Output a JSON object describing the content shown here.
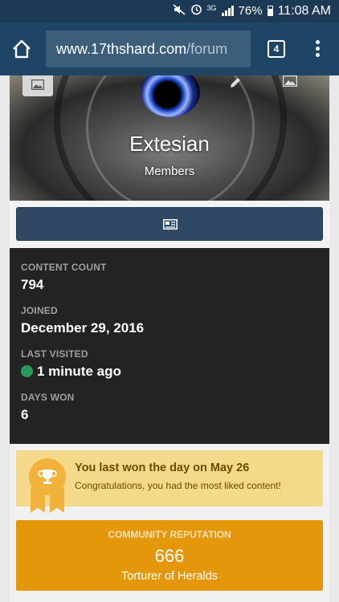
{
  "status_bar": {
    "battery": "76%",
    "time": "11:08 AM",
    "network": "3G"
  },
  "browser": {
    "url_domain": "www.17thshard.com",
    "url_path": "/forum",
    "tab_count": "4"
  },
  "profile": {
    "username": "Extesian",
    "group": "Members"
  },
  "stats": {
    "content_count_label": "CONTENT COUNT",
    "content_count": "794",
    "joined_label": "JOINED",
    "joined": "December 29, 2016",
    "last_visited_label": "LAST VISITED",
    "last_visited": "1 minute ago",
    "days_won_label": "DAYS WON",
    "days_won": "6",
    "online_color": "#2b9a5f"
  },
  "day_win": {
    "title": "You last won the day on May 26",
    "text": "Congratulations, you had the most liked content!"
  },
  "reputation": {
    "label": "COMMUNITY REPUTATION",
    "value": "666",
    "title": "Torturer of Heralds"
  },
  "colors": {
    "address_bar": "#1f4566",
    "activity_button": "#2f4965",
    "stats_bg": "#232323",
    "reputation_bg": "#e4970a",
    "day_win_bg": "#f5d98a"
  }
}
